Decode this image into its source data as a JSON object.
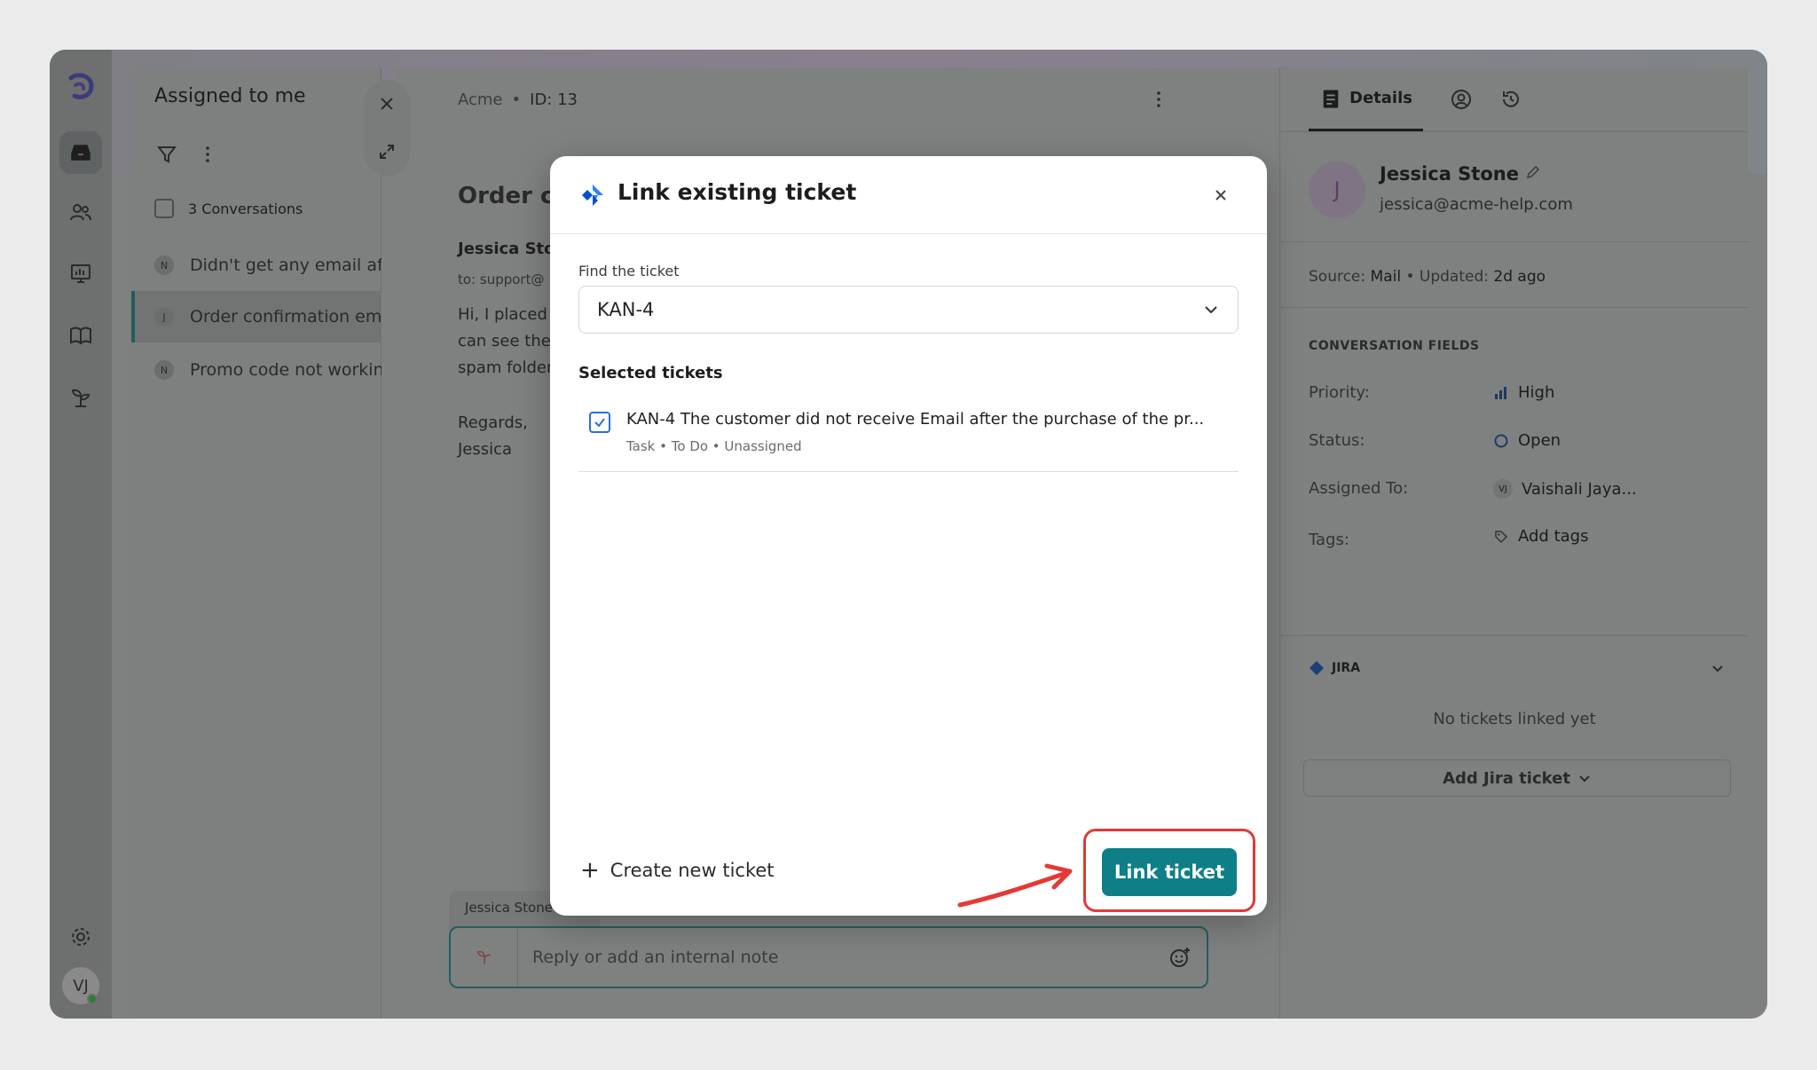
{
  "list_panel": {
    "title": "Assigned to me",
    "count_label": "3 Conversations",
    "conversations": [
      {
        "avatar": "N",
        "title": "Didn't get any email after"
      },
      {
        "avatar": "J",
        "title": "Order confirmation email"
      },
      {
        "avatar": "N",
        "title": "Promo code not working"
      }
    ]
  },
  "conversation": {
    "org": "Acme",
    "id": "ID: 13",
    "title": "Order co",
    "from": "Jessica Sto",
    "to": "to: support@",
    "body_lines": [
      "Hi, I placed a",
      "can see the",
      "spam folder"
    ],
    "sign_lines": [
      "Regards,",
      "Jessica"
    ],
    "reply_tab": "Jessica Stone",
    "reply_placeholder": "Reply or add an internal note"
  },
  "sidebar": {
    "avatar_initials": "VJ"
  },
  "right_panel": {
    "tab_details": "Details",
    "user_initial": "J",
    "user_name": "Jessica Stone",
    "user_email": "jessica@acme-help.com",
    "source_label": "Source:",
    "source_value": "Mail",
    "updated_label": "Updated:",
    "updated_value": "2d ago",
    "section_title": "CONVERSATION FIELDS",
    "fields": {
      "priority_label": "Priority:",
      "priority_value": "High",
      "status_label": "Status:",
      "status_value": "Open",
      "assigned_label": "Assigned To:",
      "assigned_initials": "VJ",
      "assigned_value": "Vaishali Jaya...",
      "tags_label": "Tags:",
      "tags_value": "Add tags"
    },
    "jira_label": "JIRA",
    "no_tickets": "No tickets linked yet",
    "add_jira_label": "Add Jira ticket"
  },
  "modal": {
    "title": "Link existing ticket",
    "find_label": "Find the ticket",
    "select_value": "KAN-4",
    "selected_label": "Selected tickets",
    "ticket": {
      "title": "KAN-4 The customer did not receive Email after the purchase of the pr...",
      "meta": "Task • To Do • Unassigned",
      "checked": true
    },
    "create_label": "Create new ticket",
    "link_label": "Link ticket"
  },
  "colors": {
    "accent": "#0e7f86",
    "highlight": "#e53935",
    "checkbox": "#2a6fd6"
  }
}
